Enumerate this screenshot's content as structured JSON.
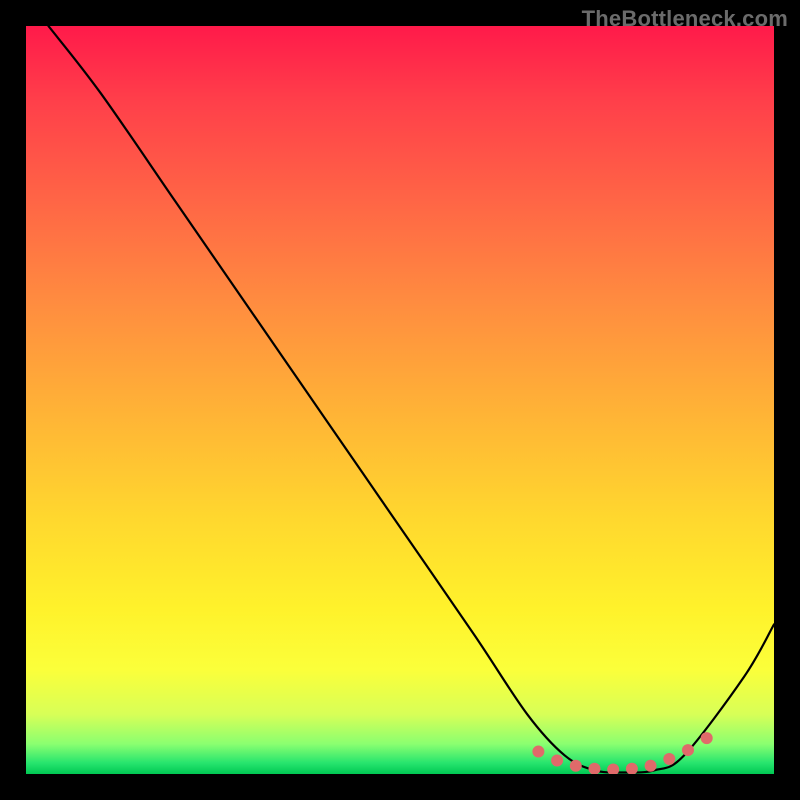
{
  "watermark": "TheBottleneck.com",
  "chart_data": {
    "type": "line",
    "title": "",
    "xlabel": "",
    "ylabel": "",
    "xlim": [
      0,
      100
    ],
    "ylim": [
      0,
      100
    ],
    "series": [
      {
        "name": "bottleneck-curve",
        "x": [
          3,
          10,
          20,
          30,
          40,
          50,
          60,
          67,
          72,
          76,
          80,
          84,
          88,
          96,
          100
        ],
        "y": [
          100,
          91,
          76.5,
          62,
          47.5,
          33,
          18.5,
          8,
          2.5,
          0.5,
          0.2,
          0.5,
          2.5,
          13,
          20
        ]
      }
    ],
    "markers": {
      "name": "optimal-range",
      "x": [
        68.5,
        71.0,
        73.5,
        76.0,
        78.5,
        81.0,
        83.5,
        86.0,
        88.5,
        91.0
      ],
      "y": [
        3.0,
        1.8,
        1.1,
        0.7,
        0.6,
        0.7,
        1.1,
        2.0,
        3.2,
        4.8
      ],
      "color": "#e06a6a",
      "radius_px": 6
    },
    "background": {
      "type": "vertical-gradient",
      "stops": [
        {
          "pos": 0.0,
          "color": "#ff1a4a"
        },
        {
          "pos": 0.25,
          "color": "#ff6a45"
        },
        {
          "pos": 0.52,
          "color": "#ffb436"
        },
        {
          "pos": 0.78,
          "color": "#fff22b"
        },
        {
          "pos": 0.96,
          "color": "#8aff70"
        },
        {
          "pos": 1.0,
          "color": "#00c853"
        }
      ]
    }
  }
}
